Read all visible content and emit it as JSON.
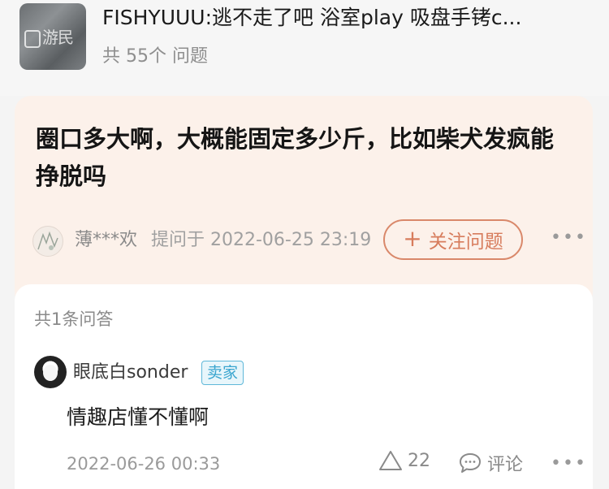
{
  "header": {
    "thumbnail_watermark": "游民",
    "product_title": "FISHYUUU:逃不走了吧 浴室play 吸盘手铐c...",
    "question_count": "共 55个 问题"
  },
  "question": {
    "text": "圈口多大啊，大概能固定多少斤，比如柴犬发疯能挣脱吗",
    "asker_name": "薄***欢",
    "asked_at": "提问于 2022-06-25 23:19",
    "follow_label": "关注问题",
    "follow_icon": "plus-icon",
    "more_icon": "more-dots-icon"
  },
  "answers": {
    "count_label": "共1条问答",
    "items": [
      {
        "name": "眼底白sonder",
        "badge": "卖家",
        "text": "情趣店懂不懂啊",
        "time": "2022-06-26 00:33",
        "likes": "22",
        "comment_label": "评论"
      }
    ]
  },
  "colors": {
    "accent": "#d77c5c",
    "card_bg": "#fcf1ea",
    "badge": "#3aa5cf"
  }
}
